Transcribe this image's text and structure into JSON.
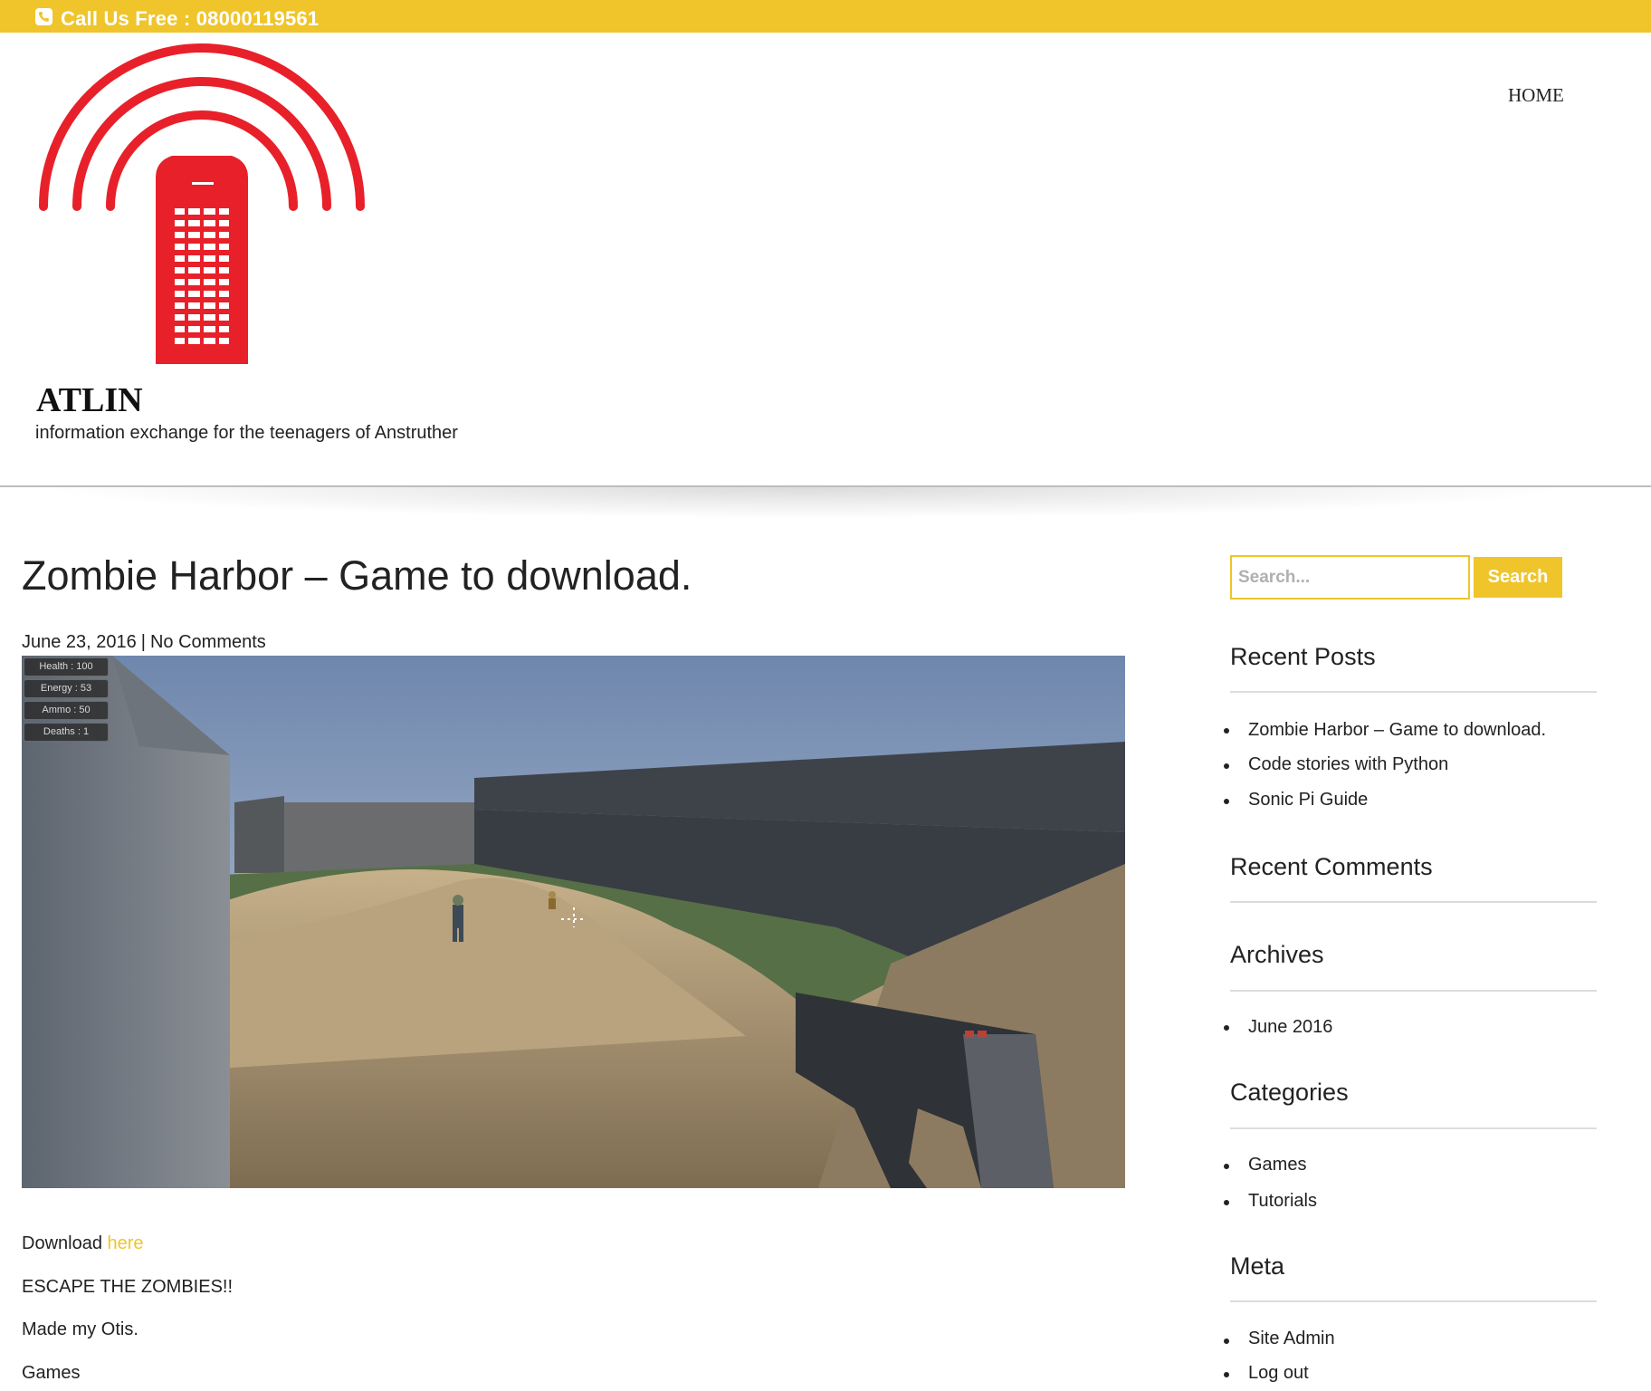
{
  "topbar": {
    "phone_icon": "phone-icon",
    "call_text": "Call Us Free : 08000119561",
    "color": "#efc52b"
  },
  "header": {
    "logo_icon": "telephone-box-broadcast-logo",
    "logo_color": "#e8202a",
    "site_title": "ATLIN",
    "tagline": "information exchange for the teenagers of Anstruther",
    "nav": {
      "home": "HOME"
    }
  },
  "post": {
    "title": "Zombie Harbor – Game to download.",
    "date": "June 23, 2016",
    "meta_separator": "|",
    "comments": "No Comments",
    "screenshot": {
      "hud": [
        "Health : 100",
        "Energy : 53",
        "Ammo : 50",
        "Deaths : 1"
      ]
    },
    "body": {
      "download_prefix": "Download ",
      "download_link": "here",
      "line2": "ESCAPE THE ZOMBIES!!",
      "line3": "Made my Otis.",
      "category": "Games"
    },
    "link_color": "#efc52b"
  },
  "sidebar": {
    "search": {
      "placeholder": "Search...",
      "button": "Search"
    },
    "recent_posts": {
      "title": "Recent Posts",
      "items": [
        "Zombie Harbor – Game to download.",
        "Code stories with Python",
        "Sonic Pi Guide"
      ]
    },
    "recent_comments": {
      "title": "Recent Comments"
    },
    "archives": {
      "title": "Archives",
      "items": [
        "June 2016"
      ]
    },
    "categories": {
      "title": "Categories",
      "items": [
        "Games",
        "Tutorials"
      ]
    },
    "meta": {
      "title": "Meta",
      "items": [
        "Site Admin",
        "Log out"
      ]
    }
  }
}
